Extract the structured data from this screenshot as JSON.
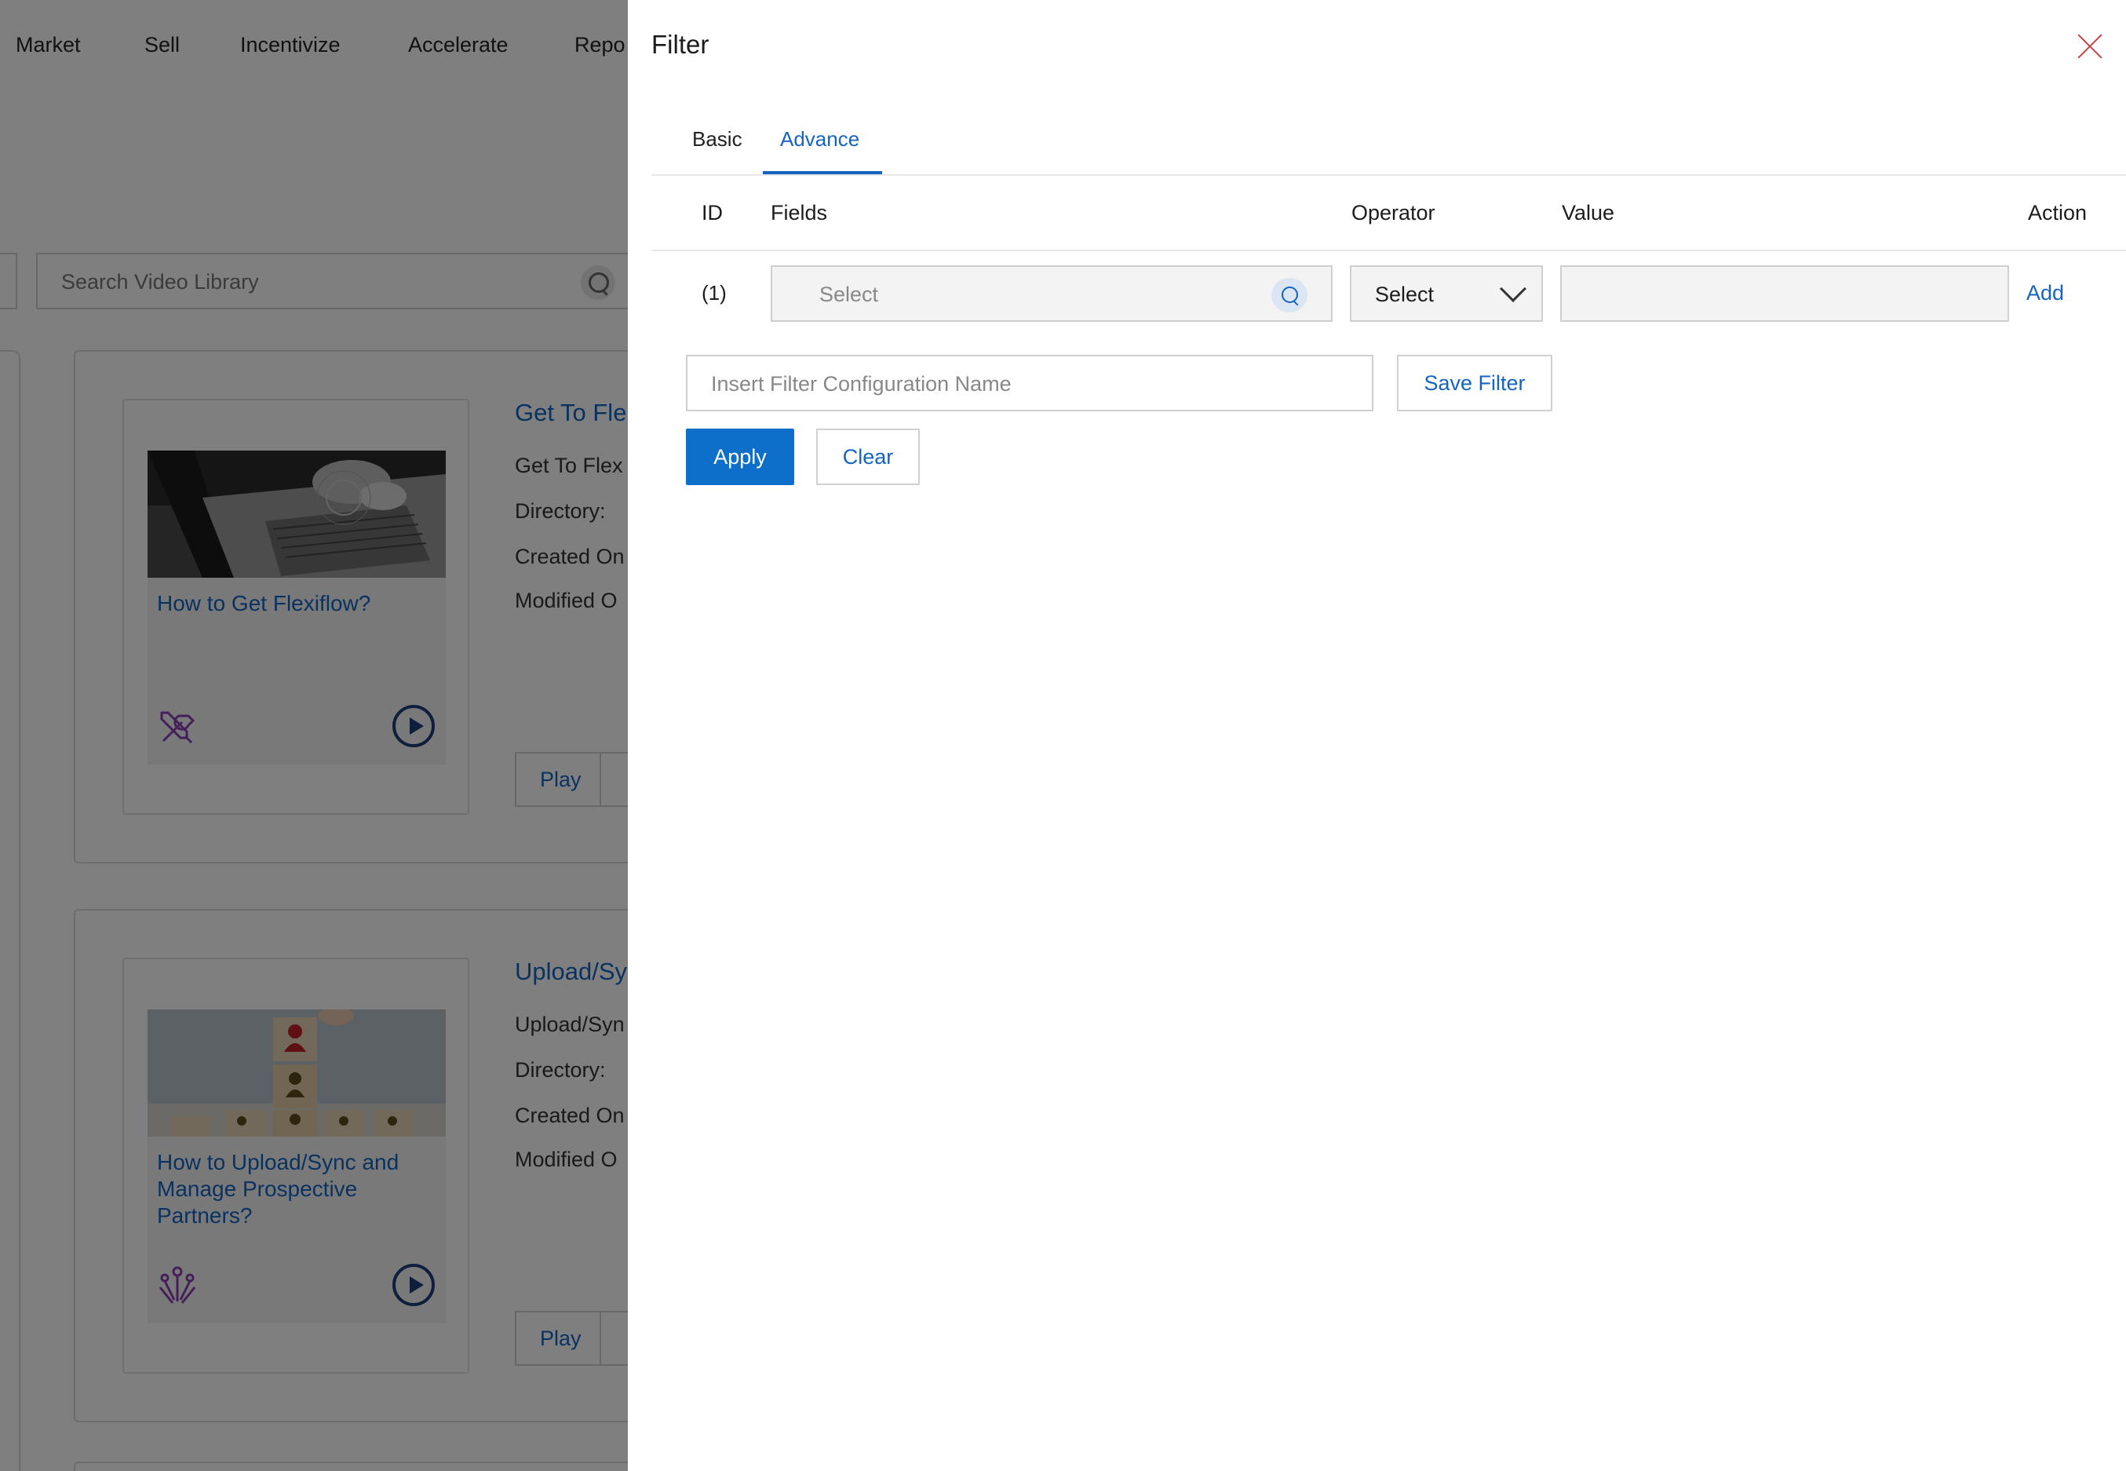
{
  "nav": {
    "items": [
      "Market",
      "Sell",
      "Incentivize",
      "Accelerate",
      "Repo"
    ]
  },
  "library": {
    "search_placeholder": "Search Video Library",
    "cards": [
      {
        "title": "Get To Fle",
        "thumb_title": "How to Get Flexiflow?",
        "line1": "Get To Flex",
        "line2": "Directory:",
        "line3": "Created On",
        "line4": "Modified O",
        "play_label": "Play",
        "icon": "tools-icon"
      },
      {
        "title": "Upload/Sy",
        "thumb_title": "How to Upload/Sync and Manage Prospective Partners?",
        "line1": "Upload/Syn",
        "line2": "Directory:",
        "line3": "Created On",
        "line4": "Modified O",
        "play_label": "Play",
        "icon": "network-icon"
      }
    ]
  },
  "filter": {
    "title": "Filter",
    "tabs": [
      {
        "label": "Basic",
        "active": false
      },
      {
        "label": "Advance",
        "active": true
      }
    ],
    "columns": {
      "id": "ID",
      "fields": "Fields",
      "operator": "Operator",
      "value": "Value",
      "action": "Action"
    },
    "row": {
      "id": "(1)",
      "fields_placeholder": "Select",
      "operator_value": "Select",
      "value": "",
      "action_label": "Add"
    },
    "config_placeholder": "Insert Filter Configuration Name",
    "save_label": "Save Filter",
    "apply_label": "Apply",
    "clear_label": "Clear"
  },
  "colors": {
    "accent": "#1565c0",
    "apply_bg": "#0d6fc9",
    "close": "#c94141",
    "overlay": "rgba(0,0,0,0.5)"
  }
}
